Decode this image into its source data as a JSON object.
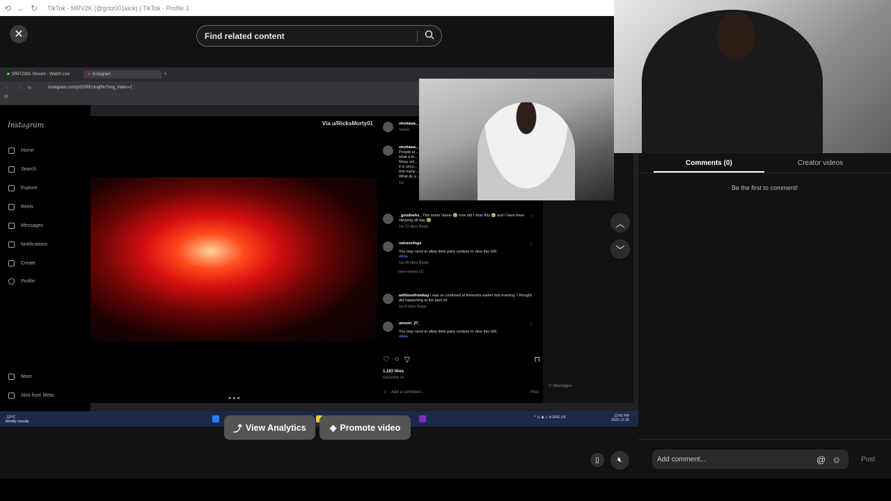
{
  "window": {
    "title": "TikTok - MRV2K (@gritz001kick) | TikTok - Profile 3"
  },
  "viewer": {
    "close_icon": "close-icon",
    "search_placeholder": "Find related content"
  },
  "browser": {
    "tabs": [
      {
        "label": "GRITZ001 Stream - Watch Live"
      },
      {
        "label": "Instagram"
      }
    ],
    "url": "instagram.com/p/DSREctrajRk/?img_index=2"
  },
  "instagram": {
    "logo": "Instagram",
    "nav": [
      {
        "label": "Home"
      },
      {
        "label": "Search"
      },
      {
        "label": "Explore"
      },
      {
        "label": "Reels"
      },
      {
        "label": "Messages"
      },
      {
        "label": "Notifications"
      },
      {
        "label": "Create"
      },
      {
        "label": "Profile"
      },
      {
        "label": "More"
      },
      {
        "label": "Also from Meta"
      }
    ],
    "media_watermark": "Via u/RicksMorty01",
    "post_author": "shottawa...",
    "post_author_sub": "Vanier",
    "caption_author": "shottawa...",
    "caption_lines": [
      "People ar...",
      "what a fe...",
      "Many onl...",
      "it is unco...",
      "this many...",
      "",
      "What do y...",
      "1w"
    ],
    "comments": [
      {
        "user": "_goodnehs_",
        "text": "This same Vanier 😭 how did I miss this 😭 and I have been sleeping all day 😭",
        "meta": "1w   12 likes   Reply"
      },
      {
        "user": "natravelings",
        "text": "You may need to allow third party cookies to view this GIF.",
        "link": "Allow",
        "meta": "1w   36 likes   Reply",
        "replies": "View replies (1)"
      },
      {
        "user": "withlovefromkay",
        "text": "I was so confused at fireworks earlier this evening. I thought def happening at the park lol.",
        "meta": "1w   6 likes   Reply"
      },
      {
        "user": "amoori_27_",
        "text": "You may need to allow third party cookies to view this GIF.",
        "link": "Allow",
        "meta": ""
      }
    ],
    "likes": "1,163 likes",
    "date": "December 14",
    "add_comment": "Add a comment...",
    "post_label": "Post",
    "messages_label": "Messages"
  },
  "taskbar": {
    "weather_temp": "-12°C",
    "weather_desc": "Mostly cloudy",
    "lang": "ENG",
    "region": "UK",
    "time": "12:41 PM",
    "date": "2025-12-28"
  },
  "actions": {
    "analytics_label": "View Analytics",
    "promote_label": "Promote video"
  },
  "comments_panel": {
    "tab_comments": "Comments (0)",
    "tab_creator": "Creator videos",
    "empty": "Be the first to comment!",
    "input_placeholder": "Add comment...",
    "post": "Post"
  }
}
